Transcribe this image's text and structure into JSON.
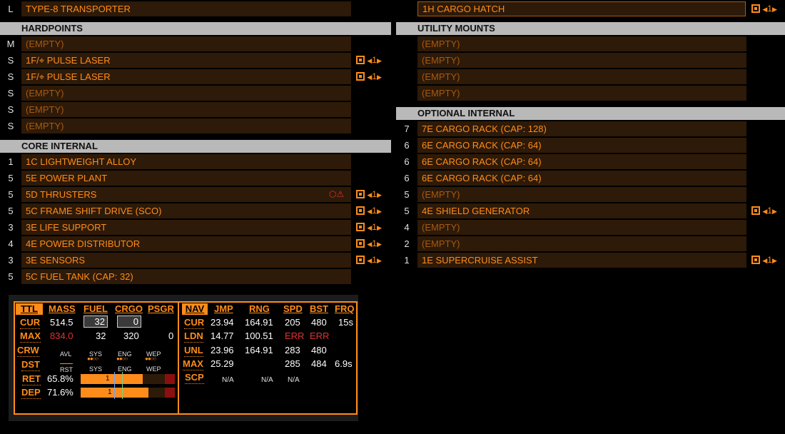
{
  "top_left": {
    "size": "L",
    "label": "TYPE-8 TRANSPORTER"
  },
  "top_right": {
    "label": "1H CARGO HATCH",
    "priority": "1"
  },
  "hardpoints": {
    "header": "HARDPOINTS",
    "rows": [
      {
        "size": "M",
        "label": "(EMPTY)",
        "empty": true,
        "priority": ""
      },
      {
        "size": "S",
        "label": "1F/⌖ PULSE LASER",
        "empty": false,
        "priority": "1"
      },
      {
        "size": "S",
        "label": "1F/⌖ PULSE LASER",
        "empty": false,
        "priority": "1"
      },
      {
        "size": "S",
        "label": "(EMPTY)",
        "empty": true,
        "priority": ""
      },
      {
        "size": "S",
        "label": "(EMPTY)",
        "empty": true,
        "priority": ""
      },
      {
        "size": "S",
        "label": "(EMPTY)",
        "empty": true,
        "priority": ""
      }
    ]
  },
  "utility": {
    "header": "UTILITY MOUNTS",
    "rows": [
      {
        "label": "(EMPTY)"
      },
      {
        "label": "(EMPTY)"
      },
      {
        "label": "(EMPTY)"
      },
      {
        "label": "(EMPTY)"
      }
    ]
  },
  "core": {
    "header": "CORE INTERNAL",
    "rows": [
      {
        "size": "1",
        "label": "1C LIGHTWEIGHT ALLOY",
        "priority": ""
      },
      {
        "size": "5",
        "label": "5E POWER PLANT",
        "priority": ""
      },
      {
        "size": "5",
        "label": "5D THRUSTERS",
        "priority": "1",
        "warn": true
      },
      {
        "size": "5",
        "label": "5C FRAME SHIFT DRIVE (SCO)",
        "priority": "1"
      },
      {
        "size": "3",
        "label": "3E LIFE SUPPORT",
        "priority": "1"
      },
      {
        "size": "4",
        "label": "4E POWER DISTRIBUTOR",
        "priority": "1"
      },
      {
        "size": "3",
        "label": "3E SENSORS",
        "priority": "1"
      },
      {
        "size": "5",
        "label": "5C FUEL TANK (CAP: 32)",
        "priority": ""
      }
    ]
  },
  "optional": {
    "header": "OPTIONAL INTERNAL",
    "rows": [
      {
        "size": "7",
        "label": "7E CARGO RACK (CAP: 128)",
        "empty": false,
        "priority": ""
      },
      {
        "size": "6",
        "label": "6E CARGO RACK (CAP: 64)",
        "empty": false,
        "priority": ""
      },
      {
        "size": "6",
        "label": "6E CARGO RACK (CAP: 64)",
        "empty": false,
        "priority": ""
      },
      {
        "size": "6",
        "label": "6E CARGO RACK (CAP: 64)",
        "empty": false,
        "priority": ""
      },
      {
        "size": "5",
        "label": "(EMPTY)",
        "empty": true,
        "priority": ""
      },
      {
        "size": "5",
        "label": "4E SHIELD GENERATOR",
        "empty": false,
        "priority": "1"
      },
      {
        "size": "4",
        "label": "(EMPTY)",
        "empty": true,
        "priority": ""
      },
      {
        "size": "2",
        "label": "(EMPTY)",
        "empty": true,
        "priority": ""
      },
      {
        "size": "1",
        "label": "1E SUPERCRUISE ASSIST",
        "empty": false,
        "priority": "1"
      }
    ]
  },
  "stats": {
    "left_headers": [
      "TTL",
      "MASS",
      "FUEL",
      "CRGO",
      "PSGR"
    ],
    "cur": {
      "label": "CUR",
      "mass": "514.5",
      "fuel": "32",
      "crgo": "0"
    },
    "max": {
      "label": "MAX",
      "mass": "834.0",
      "fuel": "32",
      "crgo": "320",
      "psgr": "0"
    },
    "crw": {
      "label": "CRW",
      "avl": "AVL",
      "sys": "SYS",
      "eng": "ENG",
      "wep": "WEP"
    },
    "dst": {
      "label": "DST",
      "rst": "RST",
      "sys": "SYS",
      "eng": "ENG",
      "wep": "WEP"
    },
    "ret": {
      "label": "RET",
      "pct": "65.8%",
      "bar_value": "1",
      "fill": 0.66
    },
    "dep": {
      "label": "DEP",
      "pct": "71.6%",
      "bar_value": "1",
      "fill": 0.72
    },
    "right_headers": [
      "NAV",
      "JMP",
      "RNG",
      "SPD",
      "BST",
      "FRQ"
    ],
    "nav_rows": [
      {
        "label": "CUR",
        "jmp": "23.94",
        "rng": "164.91",
        "spd": "205",
        "bst": "480",
        "frq": "15s"
      },
      {
        "label": "LDN",
        "jmp": "14.77",
        "rng": "100.51",
        "spd": "ERR",
        "bst": "ERR",
        "frq": ""
      },
      {
        "label": "UNL",
        "jmp": "23.96",
        "rng": "164.91",
        "spd": "283",
        "bst": "480",
        "frq": ""
      },
      {
        "label": "MAX",
        "jmp": "25.29",
        "rng": "",
        "spd": "285",
        "bst": "484",
        "frq": "6.9s"
      },
      {
        "label": "SCP",
        "jmp": "N/A",
        "rng": "N/A",
        "spd": "N/A",
        "bst": "",
        "frq": ""
      }
    ]
  },
  "colors": {
    "accent": "#ff8c1a",
    "slot_bg": "#2e1a08",
    "header_bg": "#b9b9b9",
    "error": "#e03232"
  }
}
